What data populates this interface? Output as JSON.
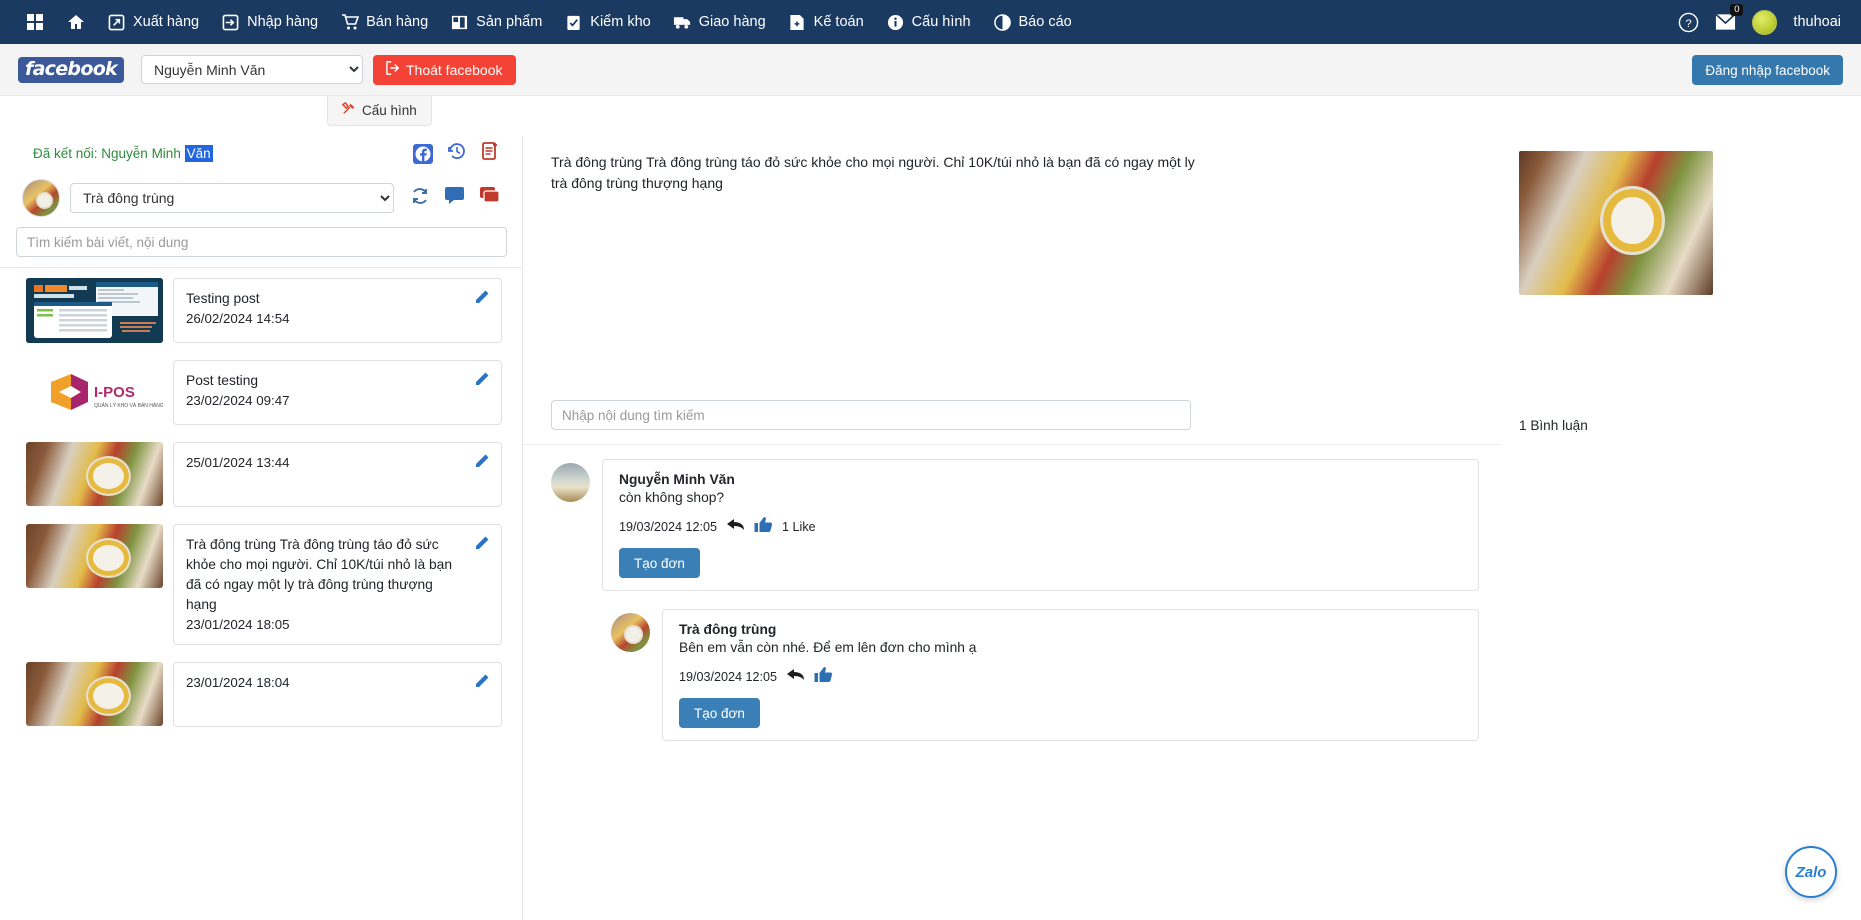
{
  "topnav": {
    "items": [
      {
        "label": "",
        "icon": "grid-icon"
      },
      {
        "label": "",
        "icon": "home-icon"
      },
      {
        "label": "Xuất hàng",
        "icon": "export-icon"
      },
      {
        "label": "Nhập hàng",
        "icon": "import-icon"
      },
      {
        "label": "Bán hàng",
        "icon": "cart-icon"
      },
      {
        "label": "Sản phẩm",
        "icon": "products-icon"
      },
      {
        "label": "Kiểm kho",
        "icon": "checklist-icon"
      },
      {
        "label": "Giao hàng",
        "icon": "truck-icon"
      },
      {
        "label": "Kế toán",
        "icon": "accounting-icon"
      },
      {
        "label": "Cấu hình",
        "icon": "info-icon"
      },
      {
        "label": "Báo cáo",
        "icon": "report-icon"
      }
    ],
    "help_icon": "question-icon",
    "mail_icon": "envelope-icon",
    "mail_badge": "0",
    "user": "thuhoai"
  },
  "fbbar": {
    "logo": "facebook",
    "account_selected": "Nguyễn Minh Văn",
    "exit_label": "Thoát facebook",
    "exit_icon": "logout-icon",
    "config_label": "Cấu hình",
    "config_icon": "tools-icon",
    "login_label": "Đăng nhập facebook"
  },
  "left": {
    "connected_prefix": "Đã kết nối: Nguyễn Minh ",
    "connected_highlight": "Văn",
    "icons": [
      "facebook-icon",
      "history-icon",
      "new-document-icon"
    ],
    "page_selected": "Trà đông trùng",
    "refresh_icon": "refresh-icon",
    "comment_icon": "comment-icon",
    "messages_icon": "messages-icon",
    "search_placeholder": "Tìm kiếm bài viết, nội dung",
    "posts": [
      {
        "title": "Testing post",
        "date": "26/02/2024 14:54",
        "thumb": "ipos-dashboard"
      },
      {
        "title": "Post testing",
        "date": "23/02/2024 09:47",
        "thumb": "ipos-logo"
      },
      {
        "title": "",
        "date": "25/01/2024 13:44",
        "thumb": "tea-product"
      },
      {
        "title": "Trà đông trùng Trà đông trùng táo đỏ sức khỏe cho mọi người. Chỉ 10K/túi nhỏ là bạn đã có ngay một ly trà đông trùng thượng hạng",
        "date": "23/01/2024 18:05",
        "thumb": "tea-product"
      },
      {
        "title": "",
        "date": "23/01/2024 18:04",
        "thumb": "tea-product"
      }
    ]
  },
  "center": {
    "post_content": "Trà đông trùng Trà đông trùng táo đỏ sức khỏe cho mọi người. Chỉ 10K/túi nhỏ là bạn đã có ngay một ly trà đông trùng thượng hạng",
    "search_placeholder": "Nhập nội dung tìm kiếm",
    "comments": [
      {
        "author": "Nguyễn Minh Văn",
        "text": "còn không shop?",
        "time": "19/03/2024 12:05",
        "reply_icon": "reply-arrow-icon",
        "like_icon": "thumbs-up-icon",
        "likes": "1 Like",
        "action_label": "Tạo đơn",
        "is_reply": false,
        "avatar": "sky-avatar"
      },
      {
        "author": "Trà đông trùng",
        "text": "Bên em vẫn còn nhé. Để em lên đơn cho mình ạ",
        "time": "19/03/2024 12:05",
        "reply_icon": "reply-arrow-icon",
        "like_icon": "thumbs-up-icon",
        "likes": "",
        "action_label": "Tạo đơn",
        "is_reply": true,
        "avatar": "food-avatar"
      }
    ]
  },
  "right": {
    "comment_count": "1 Bình luận"
  },
  "zalo": {
    "label": "Zalo"
  },
  "colors": {
    "navbar": "#1b3a62",
    "danger": "#f44336",
    "primary": "#3478ad",
    "facebook": "#3b5998",
    "connected_green": "#2e8b3d",
    "selection_blue": "#2266e0"
  }
}
